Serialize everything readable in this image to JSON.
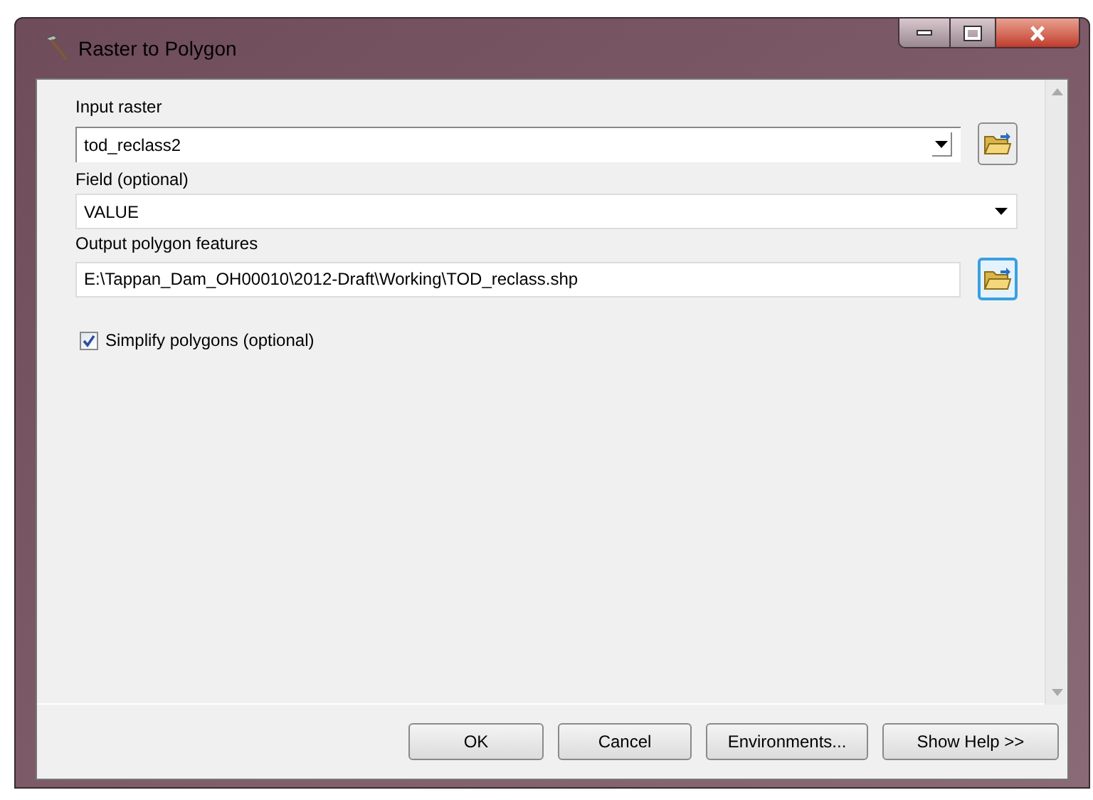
{
  "window": {
    "title": "Raster to Polygon"
  },
  "parameters": [
    {
      "kind": "combo-browse",
      "label": "Input raster",
      "value": "tod_reclass2",
      "browse_focused": false
    },
    {
      "kind": "combo",
      "label": "Field (optional)",
      "value": "VALUE"
    },
    {
      "kind": "text-browse",
      "label": "Output polygon features",
      "value": "E:\\Tappan_Dam_OH00010\\2012-Draft\\Working\\TOD_reclass.shp",
      "browse_focused": true
    },
    {
      "kind": "checkbox",
      "label": "Simplify polygons (optional)",
      "checked": true
    }
  ],
  "buttons": [
    "OK",
    "Cancel",
    "Environments...",
    "Show Help >>"
  ]
}
